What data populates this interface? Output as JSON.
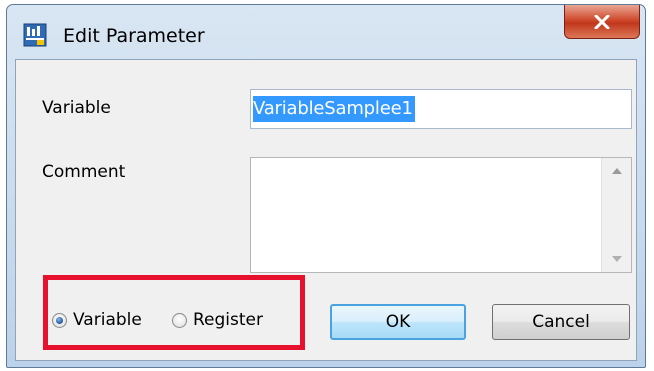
{
  "window": {
    "title": "Edit Parameter",
    "close_label": "x"
  },
  "form": {
    "variable_label": "Variable",
    "variable_value": "VariableSamplee1",
    "comment_label": "Comment",
    "comment_value": ""
  },
  "mode": {
    "options": [
      {
        "label": "Variable",
        "selected": true
      },
      {
        "label": "Register",
        "selected": false
      }
    ]
  },
  "buttons": {
    "ok_label": "OK",
    "cancel_label": "Cancel"
  },
  "colors": {
    "highlight_box": "#e8112d",
    "selection": "#3399ff",
    "default_button_border": "#4aa3df"
  }
}
